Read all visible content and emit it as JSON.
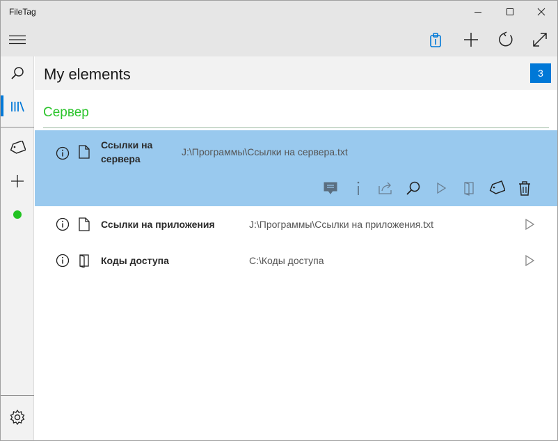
{
  "window": {
    "title": "FileTag"
  },
  "header": {
    "title": "My elements",
    "count": "3"
  },
  "group": {
    "title": "Сервер"
  },
  "items": [
    {
      "name_line1": "Ссылки на",
      "name_line2": "сервера",
      "path": "J:\\Программы\\Ссылки на сервера.txt",
      "type_icon": "file-icon",
      "selected": true
    },
    {
      "name": "Ссылки на приложения",
      "path": "J:\\Программы\\Ссылки на приложения.txt",
      "type_icon": "file-icon",
      "selected": false
    },
    {
      "name": "Коды доступа",
      "path": "C:\\Коды доступа",
      "type_icon": "folder-icon",
      "selected": false
    }
  ],
  "status": {
    "color": "#22c322"
  },
  "colors": {
    "accent": "#0078d7",
    "selected_row": "#99c9ee",
    "group_title": "#2dc42d"
  }
}
